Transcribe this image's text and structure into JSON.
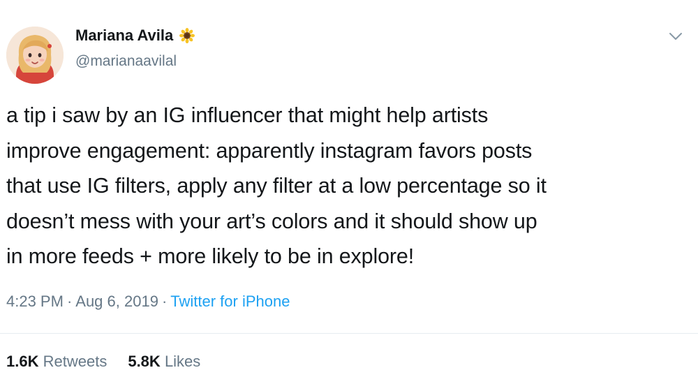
{
  "user": {
    "display_name": "Mariana Avila",
    "handle": "@marianaavilal",
    "name_emoji_icon": "sunflower-icon"
  },
  "tweet": {
    "lines": [
      "a tip i saw by an IG influencer that might help artists",
      "improve engagement: apparently instagram favors posts",
      "that use IG filters, apply any filter at a low percentage so it",
      "doesn’t mess with your art’s colors and it should show up",
      "in more feeds + more likely to be in explore!"
    ]
  },
  "meta": {
    "time": "4:23 PM",
    "separator": "·",
    "date": "Aug 6, 2019",
    "source": "Twitter for iPhone"
  },
  "stats": {
    "retweets_count": "1.6K",
    "retweets_label": "Retweets",
    "likes_count": "5.8K",
    "likes_label": "Likes"
  },
  "icons": {
    "menu": "chevron-down-icon"
  },
  "colors": {
    "text": "#14171a",
    "secondary": "#657786",
    "link": "#1da1f2",
    "divider": "#e6ecf0"
  }
}
